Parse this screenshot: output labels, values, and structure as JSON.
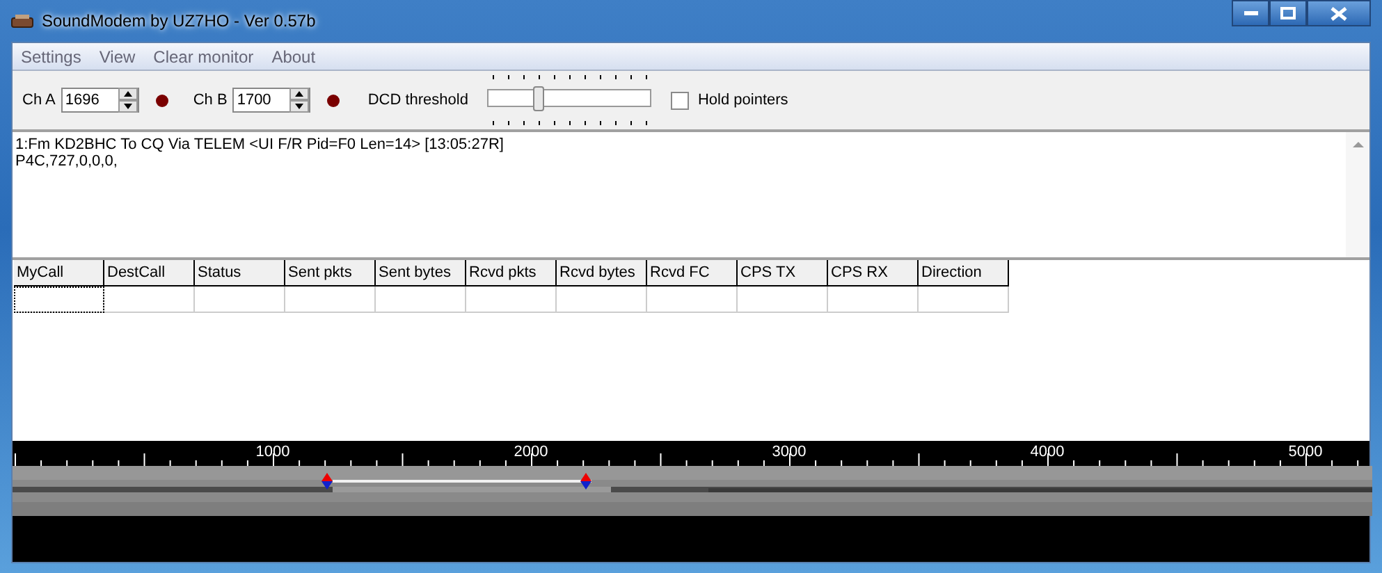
{
  "window": {
    "title": "SoundModem by UZ7HO - Ver 0.57b"
  },
  "menu": [
    "Settings",
    "View",
    "Clear monitor",
    "About"
  ],
  "toolbar": {
    "channels": [
      {
        "label": "Ch A",
        "value": "1696",
        "active": false
      },
      {
        "label": "Ch B",
        "value": "1700",
        "active": false
      }
    ],
    "dcd": {
      "label": "DCD threshold",
      "level": 0.3
    },
    "hold": {
      "label": "Hold pointers",
      "checked": false
    }
  },
  "monitor": {
    "lines": [
      "1:Fm KD2BHC To CQ Via TELEM <UI F/R Pid=F0 Len=14> [13:05:27R]",
      "P4C,727,0,0,0,"
    ]
  },
  "table": {
    "columns": [
      "MyCall",
      "DestCall",
      "Status",
      "Sent pkts",
      "Sent bytes",
      "Rcvd pkts",
      "Rcvd bytes",
      "Rcvd FC",
      "CPS TX",
      "CPS RX",
      "Direction"
    ]
  },
  "ruler": {
    "labels": [
      "1000",
      "2000",
      "3000",
      "4000",
      "5000"
    ]
  }
}
